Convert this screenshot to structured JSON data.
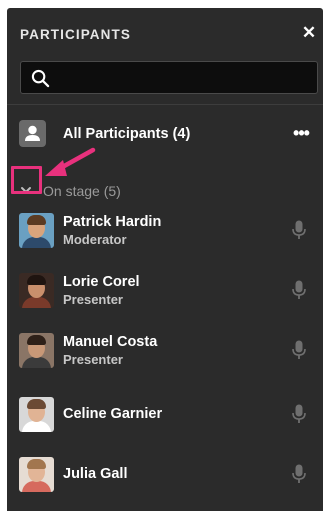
{
  "panel": {
    "title": "PARTICIPANTS",
    "close_glyph": "✕",
    "close_icon": "close-icon"
  },
  "search": {
    "placeholder": "",
    "value": "",
    "icon": "search-icon"
  },
  "all_participants": {
    "label": "All Participants (4)",
    "more_glyph": "•••",
    "icon": "person-icon"
  },
  "section": {
    "label": "On stage (5)",
    "icon": "chevron-down-icon"
  },
  "annotation": {
    "color": "#e8317d"
  },
  "participants": [
    {
      "name": "Patrick Hardin",
      "role": "Moderator",
      "mic_icon": "microphone-icon"
    },
    {
      "name": "Lorie Corel",
      "role": "Presenter",
      "mic_icon": "microphone-icon"
    },
    {
      "name": "Manuel Costa",
      "role": "Presenter",
      "mic_icon": "microphone-icon"
    },
    {
      "name": "Celine Garnier",
      "role": "",
      "mic_icon": "microphone-icon"
    },
    {
      "name": "Julia Gall",
      "role": "",
      "mic_icon": "microphone-icon"
    }
  ],
  "colors": {
    "panel_bg": "#2b2b2b",
    "search_bg": "#0d0d0d",
    "text_primary": "#ffffff",
    "text_secondary": "#9a9a9a",
    "mic_color": "#6f6f6f"
  }
}
